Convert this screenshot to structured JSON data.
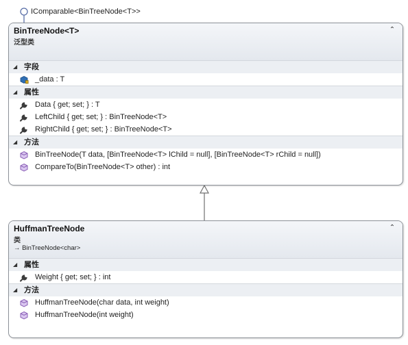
{
  "interface": {
    "label": "IComparable<BinTreeNode<T>>"
  },
  "classes": [
    {
      "name": "BinTreeNode<T>",
      "kind": "泛型类",
      "sections": [
        {
          "title": "字段",
          "members": [
            {
              "icon": "field-icon",
              "text": "_data : T"
            }
          ]
        },
        {
          "title": "属性",
          "members": [
            {
              "icon": "property-wrench-icon",
              "text": "Data { get; set; } : T"
            },
            {
              "icon": "property-wrench-icon",
              "text": "LeftChild { get; set; } : BinTreeNode<T>"
            },
            {
              "icon": "property-wrench-icon",
              "text": "RightChild { get; set; } : BinTreeNode<T>"
            }
          ]
        },
        {
          "title": "方法",
          "members": [
            {
              "icon": "method-cube-icon",
              "text": "BinTreeNode(T data, [BinTreeNode<T> lChild = null], [BinTreeNode<T> rChild = null])"
            },
            {
              "icon": "method-cube-icon",
              "text": "CompareTo(BinTreeNode<T> other) : int"
            }
          ]
        }
      ]
    },
    {
      "name": "HuffmanTreeNode",
      "kind": "类",
      "inherits": "→ BinTreeNode<char>",
      "sections": [
        {
          "title": "属性",
          "members": [
            {
              "icon": "property-wrench-icon",
              "text": "Weight { get; set; } : int"
            }
          ]
        },
        {
          "title": "方法",
          "members": [
            {
              "icon": "method-cube-icon",
              "text": "HuffmanTreeNode(char data, int weight)"
            },
            {
              "icon": "method-cube-icon",
              "text": "HuffmanTreeNode(int weight)"
            }
          ]
        }
      ]
    }
  ],
  "ui": {
    "collapse_glyph": "⌃",
    "section_glyph": "◢"
  },
  "colors": {
    "border": "#8c9198",
    "header": "#e4e8ee",
    "section": "#eceff3",
    "method_icon": "#8a5fb6",
    "field_icon": "#2f6fb4",
    "wrench_icon": "#3c3c3c"
  }
}
